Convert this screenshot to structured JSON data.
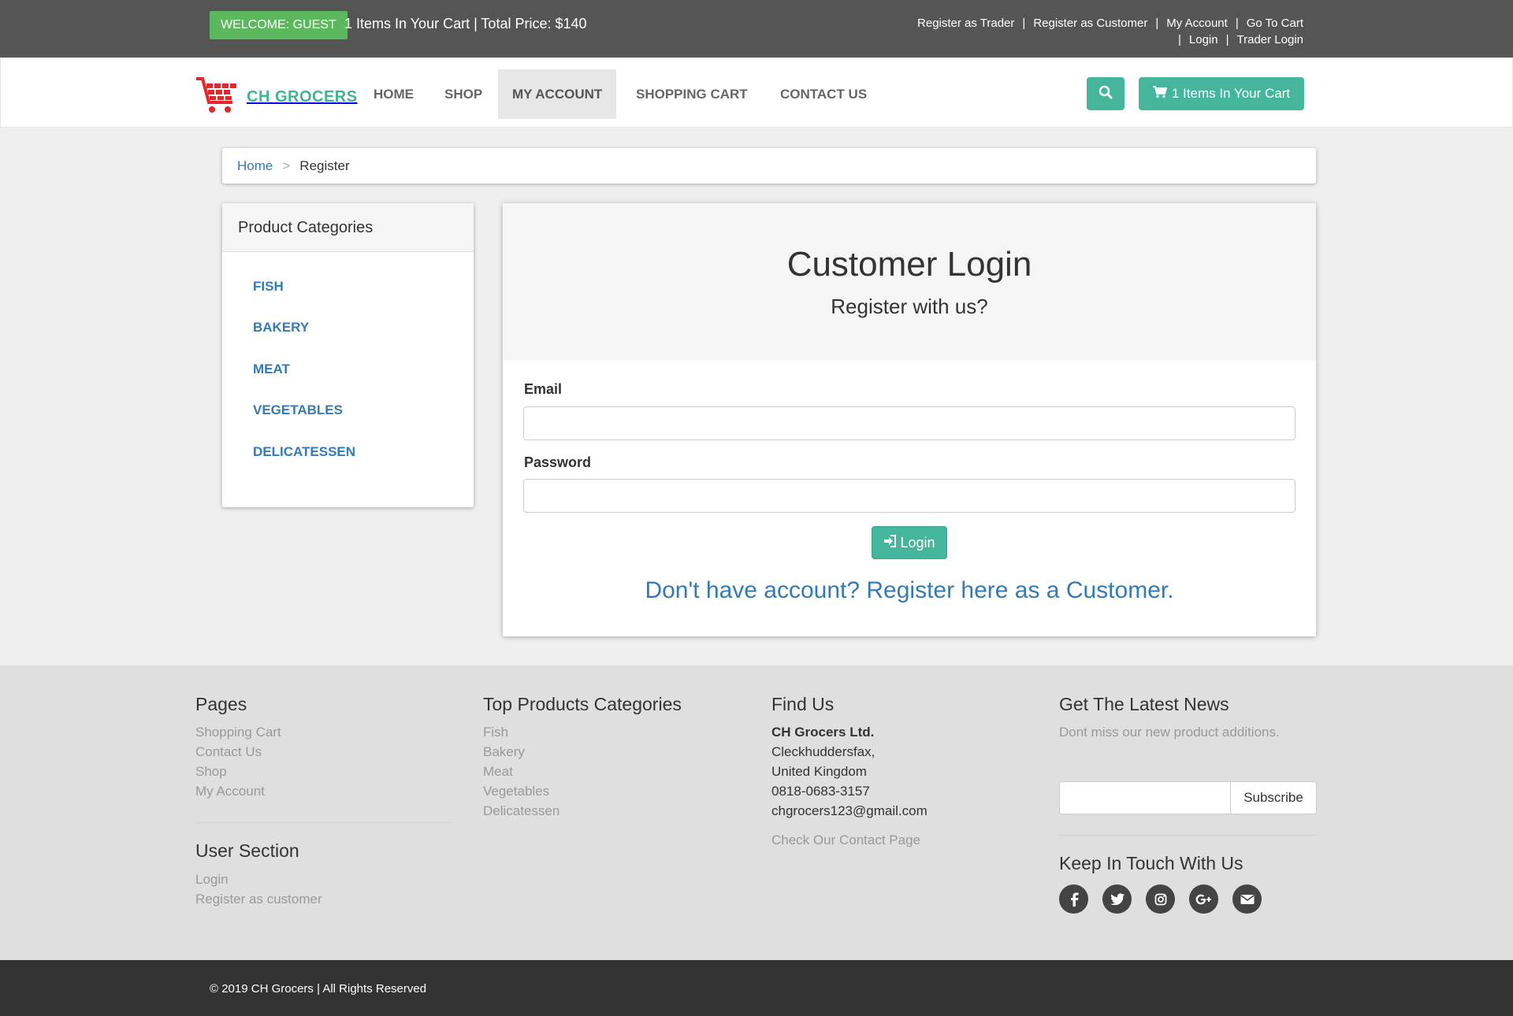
{
  "topbar": {
    "welcome": "WELCOME: GUEST",
    "cart_summary": "1 Items In Your Cart | Total Price: $140",
    "links_row1": [
      "Register as Trader",
      "Register as Customer",
      "My Account",
      "Go To Cart"
    ],
    "links_row2": [
      "Login",
      "Trader Login"
    ]
  },
  "brand": {
    "name": "CH GROCERS"
  },
  "nav": {
    "items": [
      "HOME",
      "SHOP",
      "MY ACCOUNT",
      "SHOPPING CART",
      "CONTACT US"
    ],
    "active": "MY ACCOUNT",
    "cart_button": "1 Items In Your Cart"
  },
  "breadcrumb": {
    "home": "Home",
    "separator": ">",
    "current": "Register"
  },
  "sidebar": {
    "title": "Product Categories",
    "categories": [
      "FISH",
      "BAKERY",
      "MEAT",
      "VEGETABLES",
      "DELICATESSEN"
    ]
  },
  "login": {
    "title": "Customer Login",
    "subtitle": "Register with us?",
    "email_label": "Email",
    "password_label": "Password",
    "button": "Login",
    "register_link": "Don't have account? Register here as a Customer."
  },
  "footer": {
    "pages": {
      "title": "Pages",
      "links": [
        "Shopping Cart",
        "Contact Us",
        "Shop",
        "My Account"
      ]
    },
    "user_section": {
      "title": "User Section",
      "links": [
        "Login",
        "Register as customer"
      ]
    },
    "top_categories": {
      "title": "Top Products Categories",
      "links": [
        "Fish",
        "Bakery",
        "Meat",
        "Vegetables",
        "Delicatessen"
      ]
    },
    "find_us": {
      "title": "Find Us",
      "company": "CH Grocers Ltd.",
      "address1": "Cleckhuddersfax,",
      "address2": "United Kingdom",
      "phone": "0818-0683-3157",
      "email": "chgrocers123@gmail.com",
      "contact_link": "Check Our Contact Page"
    },
    "news": {
      "title": "Get The Latest News",
      "text": "Dont miss our new product additions.",
      "subscribe": "Subscribe"
    },
    "social": {
      "title": "Keep In Touch With Us",
      "icons": [
        "facebook-icon",
        "twitter-icon",
        "instagram-icon",
        "google-plus-icon",
        "envelope-icon"
      ]
    },
    "copyright": "© 2019 CH Grocers | All Rights Reserved"
  },
  "colors": {
    "accent": "#45b69c",
    "welcome": "#5cb85c",
    "link": "#337ab7",
    "topbar": "#555555",
    "bottombar": "#333333"
  }
}
